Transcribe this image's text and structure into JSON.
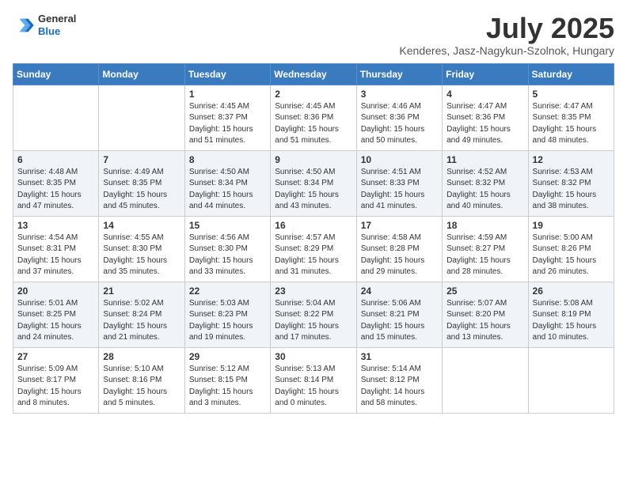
{
  "header": {
    "logo": {
      "general": "General",
      "blue": "Blue"
    },
    "title": "July 2025",
    "subtitle": "Kenderes, Jasz-Nagykun-Szolnok, Hungary"
  },
  "days_of_week": [
    "Sunday",
    "Monday",
    "Tuesday",
    "Wednesday",
    "Thursday",
    "Friday",
    "Saturday"
  ],
  "weeks": [
    [
      {
        "day": "",
        "sunrise": "",
        "sunset": "",
        "daylight": ""
      },
      {
        "day": "",
        "sunrise": "",
        "sunset": "",
        "daylight": ""
      },
      {
        "day": "1",
        "sunrise": "Sunrise: 4:45 AM",
        "sunset": "Sunset: 8:37 PM",
        "daylight": "Daylight: 15 hours and 51 minutes."
      },
      {
        "day": "2",
        "sunrise": "Sunrise: 4:45 AM",
        "sunset": "Sunset: 8:36 PM",
        "daylight": "Daylight: 15 hours and 51 minutes."
      },
      {
        "day": "3",
        "sunrise": "Sunrise: 4:46 AM",
        "sunset": "Sunset: 8:36 PM",
        "daylight": "Daylight: 15 hours and 50 minutes."
      },
      {
        "day": "4",
        "sunrise": "Sunrise: 4:47 AM",
        "sunset": "Sunset: 8:36 PM",
        "daylight": "Daylight: 15 hours and 49 minutes."
      },
      {
        "day": "5",
        "sunrise": "Sunrise: 4:47 AM",
        "sunset": "Sunset: 8:35 PM",
        "daylight": "Daylight: 15 hours and 48 minutes."
      }
    ],
    [
      {
        "day": "6",
        "sunrise": "Sunrise: 4:48 AM",
        "sunset": "Sunset: 8:35 PM",
        "daylight": "Daylight: 15 hours and 47 minutes."
      },
      {
        "day": "7",
        "sunrise": "Sunrise: 4:49 AM",
        "sunset": "Sunset: 8:35 PM",
        "daylight": "Daylight: 15 hours and 45 minutes."
      },
      {
        "day": "8",
        "sunrise": "Sunrise: 4:50 AM",
        "sunset": "Sunset: 8:34 PM",
        "daylight": "Daylight: 15 hours and 44 minutes."
      },
      {
        "day": "9",
        "sunrise": "Sunrise: 4:50 AM",
        "sunset": "Sunset: 8:34 PM",
        "daylight": "Daylight: 15 hours and 43 minutes."
      },
      {
        "day": "10",
        "sunrise": "Sunrise: 4:51 AM",
        "sunset": "Sunset: 8:33 PM",
        "daylight": "Daylight: 15 hours and 41 minutes."
      },
      {
        "day": "11",
        "sunrise": "Sunrise: 4:52 AM",
        "sunset": "Sunset: 8:32 PM",
        "daylight": "Daylight: 15 hours and 40 minutes."
      },
      {
        "day": "12",
        "sunrise": "Sunrise: 4:53 AM",
        "sunset": "Sunset: 8:32 PM",
        "daylight": "Daylight: 15 hours and 38 minutes."
      }
    ],
    [
      {
        "day": "13",
        "sunrise": "Sunrise: 4:54 AM",
        "sunset": "Sunset: 8:31 PM",
        "daylight": "Daylight: 15 hours and 37 minutes."
      },
      {
        "day": "14",
        "sunrise": "Sunrise: 4:55 AM",
        "sunset": "Sunset: 8:30 PM",
        "daylight": "Daylight: 15 hours and 35 minutes."
      },
      {
        "day": "15",
        "sunrise": "Sunrise: 4:56 AM",
        "sunset": "Sunset: 8:30 PM",
        "daylight": "Daylight: 15 hours and 33 minutes."
      },
      {
        "day": "16",
        "sunrise": "Sunrise: 4:57 AM",
        "sunset": "Sunset: 8:29 PM",
        "daylight": "Daylight: 15 hours and 31 minutes."
      },
      {
        "day": "17",
        "sunrise": "Sunrise: 4:58 AM",
        "sunset": "Sunset: 8:28 PM",
        "daylight": "Daylight: 15 hours and 29 minutes."
      },
      {
        "day": "18",
        "sunrise": "Sunrise: 4:59 AM",
        "sunset": "Sunset: 8:27 PM",
        "daylight": "Daylight: 15 hours and 28 minutes."
      },
      {
        "day": "19",
        "sunrise": "Sunrise: 5:00 AM",
        "sunset": "Sunset: 8:26 PM",
        "daylight": "Daylight: 15 hours and 26 minutes."
      }
    ],
    [
      {
        "day": "20",
        "sunrise": "Sunrise: 5:01 AM",
        "sunset": "Sunset: 8:25 PM",
        "daylight": "Daylight: 15 hours and 24 minutes."
      },
      {
        "day": "21",
        "sunrise": "Sunrise: 5:02 AM",
        "sunset": "Sunset: 8:24 PM",
        "daylight": "Daylight: 15 hours and 21 minutes."
      },
      {
        "day": "22",
        "sunrise": "Sunrise: 5:03 AM",
        "sunset": "Sunset: 8:23 PM",
        "daylight": "Daylight: 15 hours and 19 minutes."
      },
      {
        "day": "23",
        "sunrise": "Sunrise: 5:04 AM",
        "sunset": "Sunset: 8:22 PM",
        "daylight": "Daylight: 15 hours and 17 minutes."
      },
      {
        "day": "24",
        "sunrise": "Sunrise: 5:06 AM",
        "sunset": "Sunset: 8:21 PM",
        "daylight": "Daylight: 15 hours and 15 minutes."
      },
      {
        "day": "25",
        "sunrise": "Sunrise: 5:07 AM",
        "sunset": "Sunset: 8:20 PM",
        "daylight": "Daylight: 15 hours and 13 minutes."
      },
      {
        "day": "26",
        "sunrise": "Sunrise: 5:08 AM",
        "sunset": "Sunset: 8:19 PM",
        "daylight": "Daylight: 15 hours and 10 minutes."
      }
    ],
    [
      {
        "day": "27",
        "sunrise": "Sunrise: 5:09 AM",
        "sunset": "Sunset: 8:17 PM",
        "daylight": "Daylight: 15 hours and 8 minutes."
      },
      {
        "day": "28",
        "sunrise": "Sunrise: 5:10 AM",
        "sunset": "Sunset: 8:16 PM",
        "daylight": "Daylight: 15 hours and 5 minutes."
      },
      {
        "day": "29",
        "sunrise": "Sunrise: 5:12 AM",
        "sunset": "Sunset: 8:15 PM",
        "daylight": "Daylight: 15 hours and 3 minutes."
      },
      {
        "day": "30",
        "sunrise": "Sunrise: 5:13 AM",
        "sunset": "Sunset: 8:14 PM",
        "daylight": "Daylight: 15 hours and 0 minutes."
      },
      {
        "day": "31",
        "sunrise": "Sunrise: 5:14 AM",
        "sunset": "Sunset: 8:12 PM",
        "daylight": "Daylight: 14 hours and 58 minutes."
      },
      {
        "day": "",
        "sunrise": "",
        "sunset": "",
        "daylight": ""
      },
      {
        "day": "",
        "sunrise": "",
        "sunset": "",
        "daylight": ""
      }
    ]
  ]
}
